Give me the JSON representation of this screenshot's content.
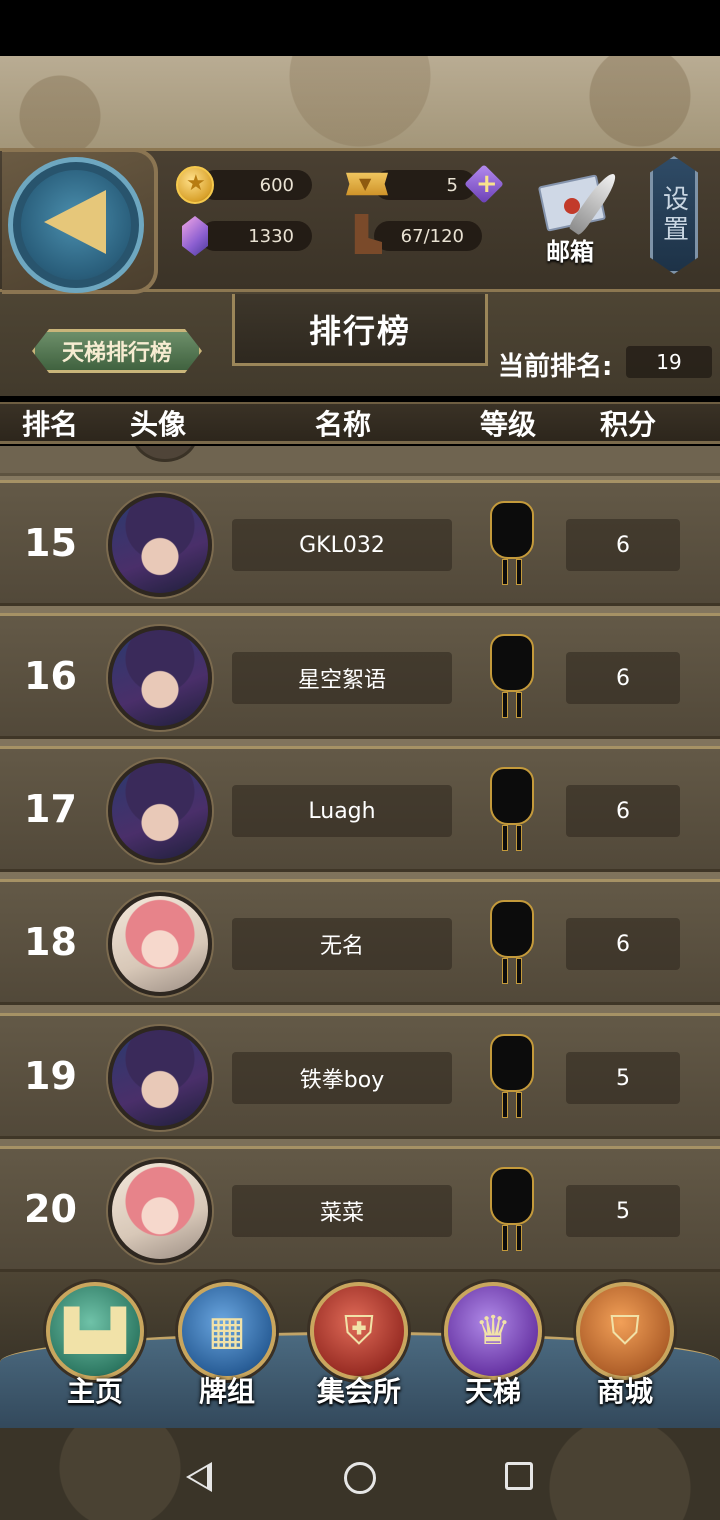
{
  "currency": {
    "gold": "600",
    "crystal": "1330",
    "ticket": "5",
    "stamina": "67/120"
  },
  "header": {
    "mail_label": "邮箱",
    "settings_label": "设置"
  },
  "subheader": {
    "ladder_tab": "天梯排行榜",
    "title": "排行榜",
    "current_rank_label": "当前排名:",
    "current_rank_value": "19"
  },
  "table": {
    "columns": [
      "排名",
      "头像",
      "名称",
      "等级",
      "积分"
    ],
    "rows": [
      {
        "rank": "15",
        "name": "GKL032",
        "score": "6",
        "avatar": "witch-avatar"
      },
      {
        "rank": "16",
        "name": "星空絮语",
        "score": "6",
        "avatar": "witch-avatar"
      },
      {
        "rank": "17",
        "name": "Luagh",
        "score": "6",
        "avatar": "witch-avatar"
      },
      {
        "rank": "18",
        "name": "无名",
        "score": "6",
        "avatar": "pink-hair-avatar"
      },
      {
        "rank": "19",
        "name": "铁拳boy",
        "score": "5",
        "avatar": "witch-avatar"
      },
      {
        "rank": "20",
        "name": "菜菜",
        "score": "5",
        "avatar": "pink-hair-avatar"
      }
    ]
  },
  "nav": {
    "items": [
      {
        "label": "主页",
        "icon": "castle-icon",
        "color": "#3f8a77"
      },
      {
        "label": "牌组",
        "icon": "cards-icon",
        "color": "#2f6aa0"
      },
      {
        "label": "集会所",
        "icon": "shield-sword-icon",
        "color": "#a0352c"
      },
      {
        "label": "天梯",
        "icon": "trophy-icon",
        "color": "#6c3aa0"
      },
      {
        "label": "商城",
        "icon": "shop-sign-icon",
        "color": "#b2622a"
      }
    ]
  }
}
